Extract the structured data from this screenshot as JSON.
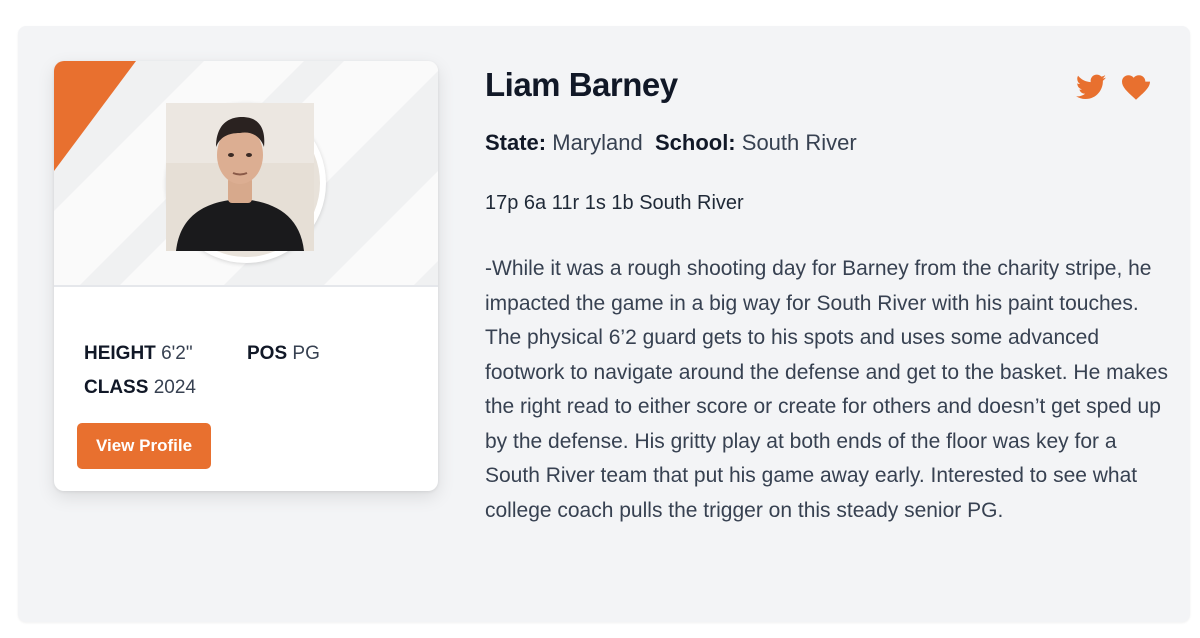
{
  "player": {
    "name": "Liam Barney",
    "state_label": "State:",
    "state": "Maryland",
    "school_label": "School:",
    "school": "South River",
    "statline": "17p 6a 11r 1s 1b South River",
    "description": "-While it was a rough shooting day for Barney from the charity stripe, he impacted the game in a big way for South River with his paint touches. The physical 6’2 guard gets to his spots and uses some advanced footwork to navigate around the defense and get to the basket. He makes the right read to either score or create for others and doesn’t get sped up by the defense. His gritty play at both ends of the floor was key for a South River team that put his game away early. Interested to see what college coach pulls the trigger on this steady senior PG."
  },
  "card": {
    "height_label": "HEIGHT",
    "height": "6'2\"",
    "pos_label": "POS",
    "pos": "PG",
    "class_label": "CLASS",
    "class": "2024",
    "button_label": "View Profile"
  },
  "icons": {
    "twitter": "twitter-icon",
    "favorite": "heart-icon"
  },
  "colors": {
    "accent": "#e8702f",
    "panel_bg": "#f3f4f6",
    "heading": "#111827",
    "body_text": "#374151"
  }
}
